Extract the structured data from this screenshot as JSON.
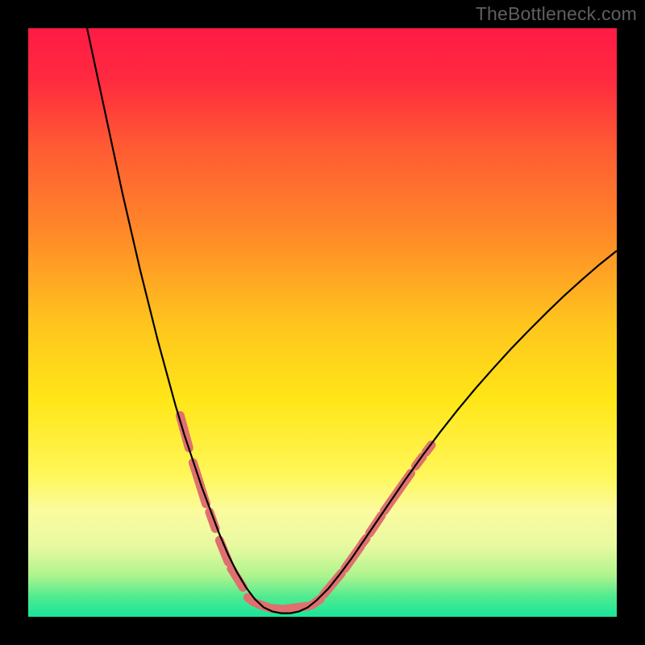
{
  "watermark": "TheBottleneck.com",
  "chart_data": {
    "type": "line",
    "title": "",
    "xlabel": "",
    "ylabel": "",
    "xlim": [
      0,
      100
    ],
    "ylim": [
      0,
      100
    ],
    "background_gradient": {
      "stops": [
        {
          "offset": 0.0,
          "color": "#ff1a45"
        },
        {
          "offset": 0.09,
          "color": "#ff2b3f"
        },
        {
          "offset": 0.2,
          "color": "#ff5a33"
        },
        {
          "offset": 0.35,
          "color": "#ff8a28"
        },
        {
          "offset": 0.5,
          "color": "#ffc41e"
        },
        {
          "offset": 0.63,
          "color": "#ffe617"
        },
        {
          "offset": 0.76,
          "color": "#fff75a"
        },
        {
          "offset": 0.82,
          "color": "#fbfb9f"
        },
        {
          "offset": 0.88,
          "color": "#e8f9a0"
        },
        {
          "offset": 0.93,
          "color": "#aef48e"
        },
        {
          "offset": 0.965,
          "color": "#52eb8f"
        },
        {
          "offset": 1.0,
          "color": "#18e59b"
        }
      ]
    },
    "series": [
      {
        "name": "bottleneck-curve",
        "color": "#000000",
        "width": 2.2,
        "points": [
          {
            "x": 10.0,
            "y": 100.0
          },
          {
            "x": 11.5,
            "y": 93.0
          },
          {
            "x": 13.0,
            "y": 86.0
          },
          {
            "x": 14.5,
            "y": 79.0
          },
          {
            "x": 16.0,
            "y": 72.0
          },
          {
            "x": 17.5,
            "y": 65.5
          },
          {
            "x": 19.0,
            "y": 59.0
          },
          {
            "x": 20.5,
            "y": 53.0
          },
          {
            "x": 22.0,
            "y": 47.0
          },
          {
            "x": 23.5,
            "y": 41.5
          },
          {
            "x": 25.0,
            "y": 36.0
          },
          {
            "x": 26.5,
            "y": 31.0
          },
          {
            "x": 28.0,
            "y": 26.5
          },
          {
            "x": 29.5,
            "y": 22.0
          },
          {
            "x": 31.0,
            "y": 18.0
          },
          {
            "x": 32.5,
            "y": 14.0
          },
          {
            "x": 34.0,
            "y": 10.5
          },
          {
            "x": 35.5,
            "y": 7.5
          },
          {
            "x": 37.0,
            "y": 5.0
          },
          {
            "x": 38.5,
            "y": 3.0
          },
          {
            "x": 40.0,
            "y": 1.6
          },
          {
            "x": 41.5,
            "y": 0.9
          },
          {
            "x": 43.0,
            "y": 0.6
          },
          {
            "x": 44.5,
            "y": 0.6
          },
          {
            "x": 46.0,
            "y": 0.9
          },
          {
            "x": 47.5,
            "y": 1.6
          },
          {
            "x": 49.0,
            "y": 2.8
          },
          {
            "x": 51.0,
            "y": 4.8
          },
          {
            "x": 53.0,
            "y": 7.3
          },
          {
            "x": 55.0,
            "y": 10.0
          },
          {
            "x": 58.0,
            "y": 14.4
          },
          {
            "x": 61.0,
            "y": 18.8
          },
          {
            "x": 64.0,
            "y": 23.2
          },
          {
            "x": 67.0,
            "y": 27.4
          },
          {
            "x": 70.0,
            "y": 31.4
          },
          {
            "x": 73.0,
            "y": 35.2
          },
          {
            "x": 76.0,
            "y": 38.8
          },
          {
            "x": 79.0,
            "y": 42.2
          },
          {
            "x": 82.0,
            "y": 45.5
          },
          {
            "x": 85.0,
            "y": 48.6
          },
          {
            "x": 88.0,
            "y": 51.6
          },
          {
            "x": 91.0,
            "y": 54.5
          },
          {
            "x": 94.0,
            "y": 57.2
          },
          {
            "x": 97.0,
            "y": 59.8
          },
          {
            "x": 100.0,
            "y": 62.2
          }
        ]
      }
    ],
    "overlay_segments": {
      "color": "#e0706f",
      "width": 11,
      "linecap": "round",
      "left_arm": [
        {
          "x1": 25.8,
          "y1": 34.2,
          "x2": 27.3,
          "y2": 28.7
        },
        {
          "x1": 28.0,
          "y1": 26.2,
          "x2": 30.2,
          "y2": 19.2
        },
        {
          "x1": 30.8,
          "y1": 17.8,
          "x2": 31.8,
          "y2": 15.0
        },
        {
          "x1": 32.5,
          "y1": 13.0,
          "x2": 34.0,
          "y2": 9.3
        },
        {
          "x1": 34.5,
          "y1": 8.2,
          "x2": 36.5,
          "y2": 5.0
        }
      ],
      "right_arm": [
        {
          "x1": 50.2,
          "y1": 3.8,
          "x2": 53.2,
          "y2": 7.4
        },
        {
          "x1": 53.8,
          "y1": 8.2,
          "x2": 56.5,
          "y2": 12.0
        },
        {
          "x1": 56.8,
          "y1": 12.5,
          "x2": 57.4,
          "y2": 13.3
        },
        {
          "x1": 58.0,
          "y1": 14.2,
          "x2": 60.0,
          "y2": 17.2
        },
        {
          "x1": 60.5,
          "y1": 18.0,
          "x2": 65.0,
          "y2": 24.4
        },
        {
          "x1": 65.8,
          "y1": 25.6,
          "x2": 67.0,
          "y2": 27.2
        },
        {
          "x1": 67.6,
          "y1": 28.0,
          "x2": 68.5,
          "y2": 29.2
        }
      ],
      "valley": [
        {
          "x1": 37.3,
          "y1": 3.3,
          "x2": 38.3,
          "y2": 2.5
        },
        {
          "x1": 39.0,
          "y1": 2.2,
          "x2": 41.0,
          "y2": 1.5
        },
        {
          "x1": 41.5,
          "y1": 1.4,
          "x2": 43.0,
          "y2": 1.3
        },
        {
          "x1": 43.6,
          "y1": 1.3,
          "x2": 47.5,
          "y2": 1.8
        },
        {
          "x1": 48.2,
          "y1": 2.0,
          "x2": 49.6,
          "y2": 3.0
        }
      ]
    }
  }
}
